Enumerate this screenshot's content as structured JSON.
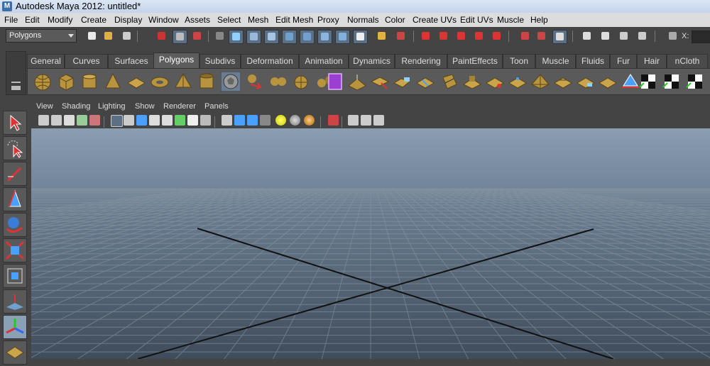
{
  "window": {
    "title": "Autodesk Maya 2012: untitled*",
    "logo_icon": "maya-logo-icon"
  },
  "menubar": {
    "items": [
      "File",
      "Edit",
      "Modify",
      "Create",
      "Display",
      "Window",
      "Assets",
      "Select",
      "Mesh",
      "Edit Mesh",
      "Proxy",
      "Normals",
      "Color",
      "Create UVs",
      "Edit UVs",
      "Muscle",
      "Help"
    ]
  },
  "statusline": {
    "menu_set": "Polygons",
    "x_label": "X:"
  },
  "shelf": {
    "tabs": [
      "General",
      "Curves",
      "Surfaces",
      "Polygons",
      "Subdivs",
      "Deformation",
      "Animation",
      "Dynamics",
      "Rendering",
      "PaintEffects",
      "Toon",
      "Muscle",
      "Fluids",
      "Fur",
      "Hair",
      "nCloth"
    ],
    "active_tab": "Polygons",
    "tools": [
      "poly-sphere-icon",
      "poly-cube-icon",
      "poly-cylinder-icon",
      "poly-cone-icon",
      "poly-plane-icon",
      "poly-torus-icon",
      "poly-pyramid-icon",
      "poly-pipe-icon",
      "poly-soccer-ball-icon",
      "combine-icon",
      "separate-icon",
      "extract-icon",
      "smooth-icon",
      "boolean-icon",
      "average-vertices-icon",
      "bridge-icon",
      "append-polygon-icon",
      "split-polygon-icon",
      "insert-edge-loop-icon",
      "extrude-icon",
      "bevel-icon",
      "merge-vertices-icon",
      "sculpt-icon",
      "wedge-icon",
      "poke-icon",
      "planar-mapping-icon",
      "cylindrical-mapping-icon",
      "spherical-mapping-icon",
      "automatic-mapping-icon",
      "uv-texture-editor-icon",
      "checker-icon"
    ]
  },
  "toolbox": {
    "tools": [
      "select-tool-icon",
      "lasso-tool-icon",
      "paint-select-tool-icon",
      "move-tool-icon",
      "rotate-tool-icon",
      "scale-tool-icon",
      "universal-manipulator-icon",
      "soft-modification-icon",
      "show-manipulator-icon",
      "last-tool-icon"
    ]
  },
  "viewport": {
    "menus": [
      "View",
      "Shading",
      "Lighting",
      "Show",
      "Renderer",
      "Panels"
    ],
    "toolbar_icons": [
      "camera-icon",
      "bookmark-icon",
      "image-plane-icon",
      "grid-icon",
      "film-gate-icon",
      "wireframe-icon",
      "smooth-shade-icon",
      "texture-icon",
      "lights-icon",
      "shadows-icon",
      "xray-icon",
      "isolate-icon",
      "high-quality-icon",
      "resolution-gate-icon",
      "cube-icon",
      "checker-icon",
      "light-icon"
    ],
    "grid": "perspective-grid"
  },
  "colors": {
    "titlebar": "#c8d7ea",
    "menubar": "#dcdcdc",
    "ui_bg": "#444444",
    "shelf_bg": "#5a5a5a",
    "viewport_top": "#8a9db1",
    "viewport_bottom": "#3f4c5b",
    "active_tool": "#8aa0b5"
  }
}
